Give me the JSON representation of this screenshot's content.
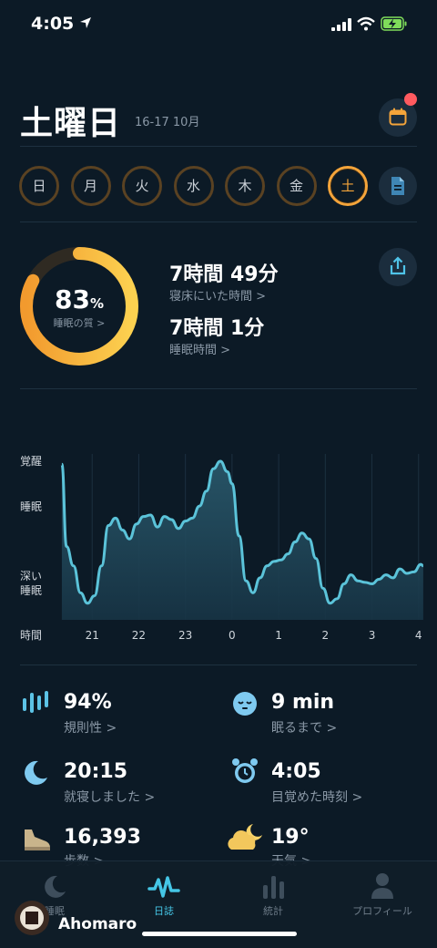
{
  "status_bar": {
    "time": "4:05"
  },
  "header": {
    "title": "土曜日",
    "date": "16-17 10月"
  },
  "week": [
    {
      "label": "日",
      "selected": false
    },
    {
      "label": "月",
      "selected": false
    },
    {
      "label": "火",
      "selected": false
    },
    {
      "label": "水",
      "selected": false
    },
    {
      "label": "木",
      "selected": false
    },
    {
      "label": "金",
      "selected": false
    },
    {
      "label": "土",
      "selected": true
    }
  ],
  "summary": {
    "quality_value": "83",
    "quality_unit": "%",
    "quality_fraction": 0.83,
    "quality_label": "睡眠の質 >",
    "in_bed_value": "7時間 49分",
    "in_bed_label": "寝床にいた時間 >",
    "asleep_value": "7時間 1分",
    "asleep_label": "睡眠時間 >"
  },
  "chart_data": {
    "type": "area",
    "y_labels": [
      "覚醒",
      "睡眠",
      "深い\n睡眠"
    ],
    "x_axis_label": "時間",
    "x_ticks": [
      "21",
      "22",
      "23",
      "0",
      "1",
      "2",
      "3",
      "4"
    ],
    "series_color": "#5bc3d9",
    "note": "sleep depth: 0 = 深い睡眠, 1 = 覚醒",
    "x": [
      20.35,
      20.45,
      20.6,
      20.75,
      20.9,
      21.05,
      21.2,
      21.35,
      21.5,
      21.65,
      21.8,
      21.95,
      22.1,
      22.25,
      22.4,
      22.55,
      22.7,
      22.85,
      23.0,
      23.15,
      23.3,
      23.45,
      23.6,
      23.75,
      23.9,
      24.0,
      24.15,
      24.3,
      24.45,
      24.6,
      24.75,
      24.9,
      25.05,
      25.2,
      25.35,
      25.5,
      25.65,
      25.8,
      25.95,
      26.1,
      26.25,
      26.4,
      26.55,
      26.7,
      26.85,
      27.0,
      27.15,
      27.3,
      27.45,
      27.6,
      27.75,
      27.9,
      28.05,
      28.1
    ],
    "values": [
      0.98,
      0.43,
      0.3,
      0.12,
      0.05,
      0.1,
      0.3,
      0.57,
      0.62,
      0.54,
      0.48,
      0.58,
      0.63,
      0.64,
      0.56,
      0.63,
      0.61,
      0.55,
      0.6,
      0.62,
      0.7,
      0.8,
      0.95,
      1.0,
      0.93,
      0.85,
      0.5,
      0.2,
      0.12,
      0.22,
      0.3,
      0.33,
      0.34,
      0.38,
      0.46,
      0.52,
      0.48,
      0.35,
      0.15,
      0.05,
      0.08,
      0.18,
      0.24,
      0.2,
      0.19,
      0.18,
      0.21,
      0.24,
      0.22,
      0.28,
      0.25,
      0.26,
      0.31,
      0.3
    ]
  },
  "metrics": [
    {
      "value": "94%",
      "label": "規則性 >",
      "icon": "regularity-bars-icon"
    },
    {
      "value": "9 min",
      "label": "眠るまで >",
      "icon": "sleepy-face-icon"
    },
    {
      "value": "20:15",
      "label": "就寝しました >",
      "icon": "moon-icon"
    },
    {
      "value": "4:05",
      "label": "目覚めた時刻 >",
      "icon": "alarm-clock-icon"
    },
    {
      "value": "16,393",
      "label": "歩数 >",
      "icon": "shoe-icon"
    },
    {
      "value": "19°",
      "label": "天気 >",
      "icon": "weather-cloud-moon-icon"
    }
  ],
  "tabs": [
    {
      "label": "睡眠",
      "icon": "moon-icon",
      "active": false
    },
    {
      "label": "日誌",
      "icon": "wave-icon",
      "active": true
    },
    {
      "label": "統計",
      "icon": "bars-icon",
      "active": false
    },
    {
      "label": "プロフィール",
      "icon": "person-icon",
      "active": false
    }
  ],
  "watermark": {
    "name": "Ahomaro"
  },
  "colors": {
    "background": "#0c1a26",
    "accent": "#f4a43a",
    "chart": "#5bc3d9",
    "active_tab": "#45c6e6",
    "badge": "#ff5a5f"
  }
}
